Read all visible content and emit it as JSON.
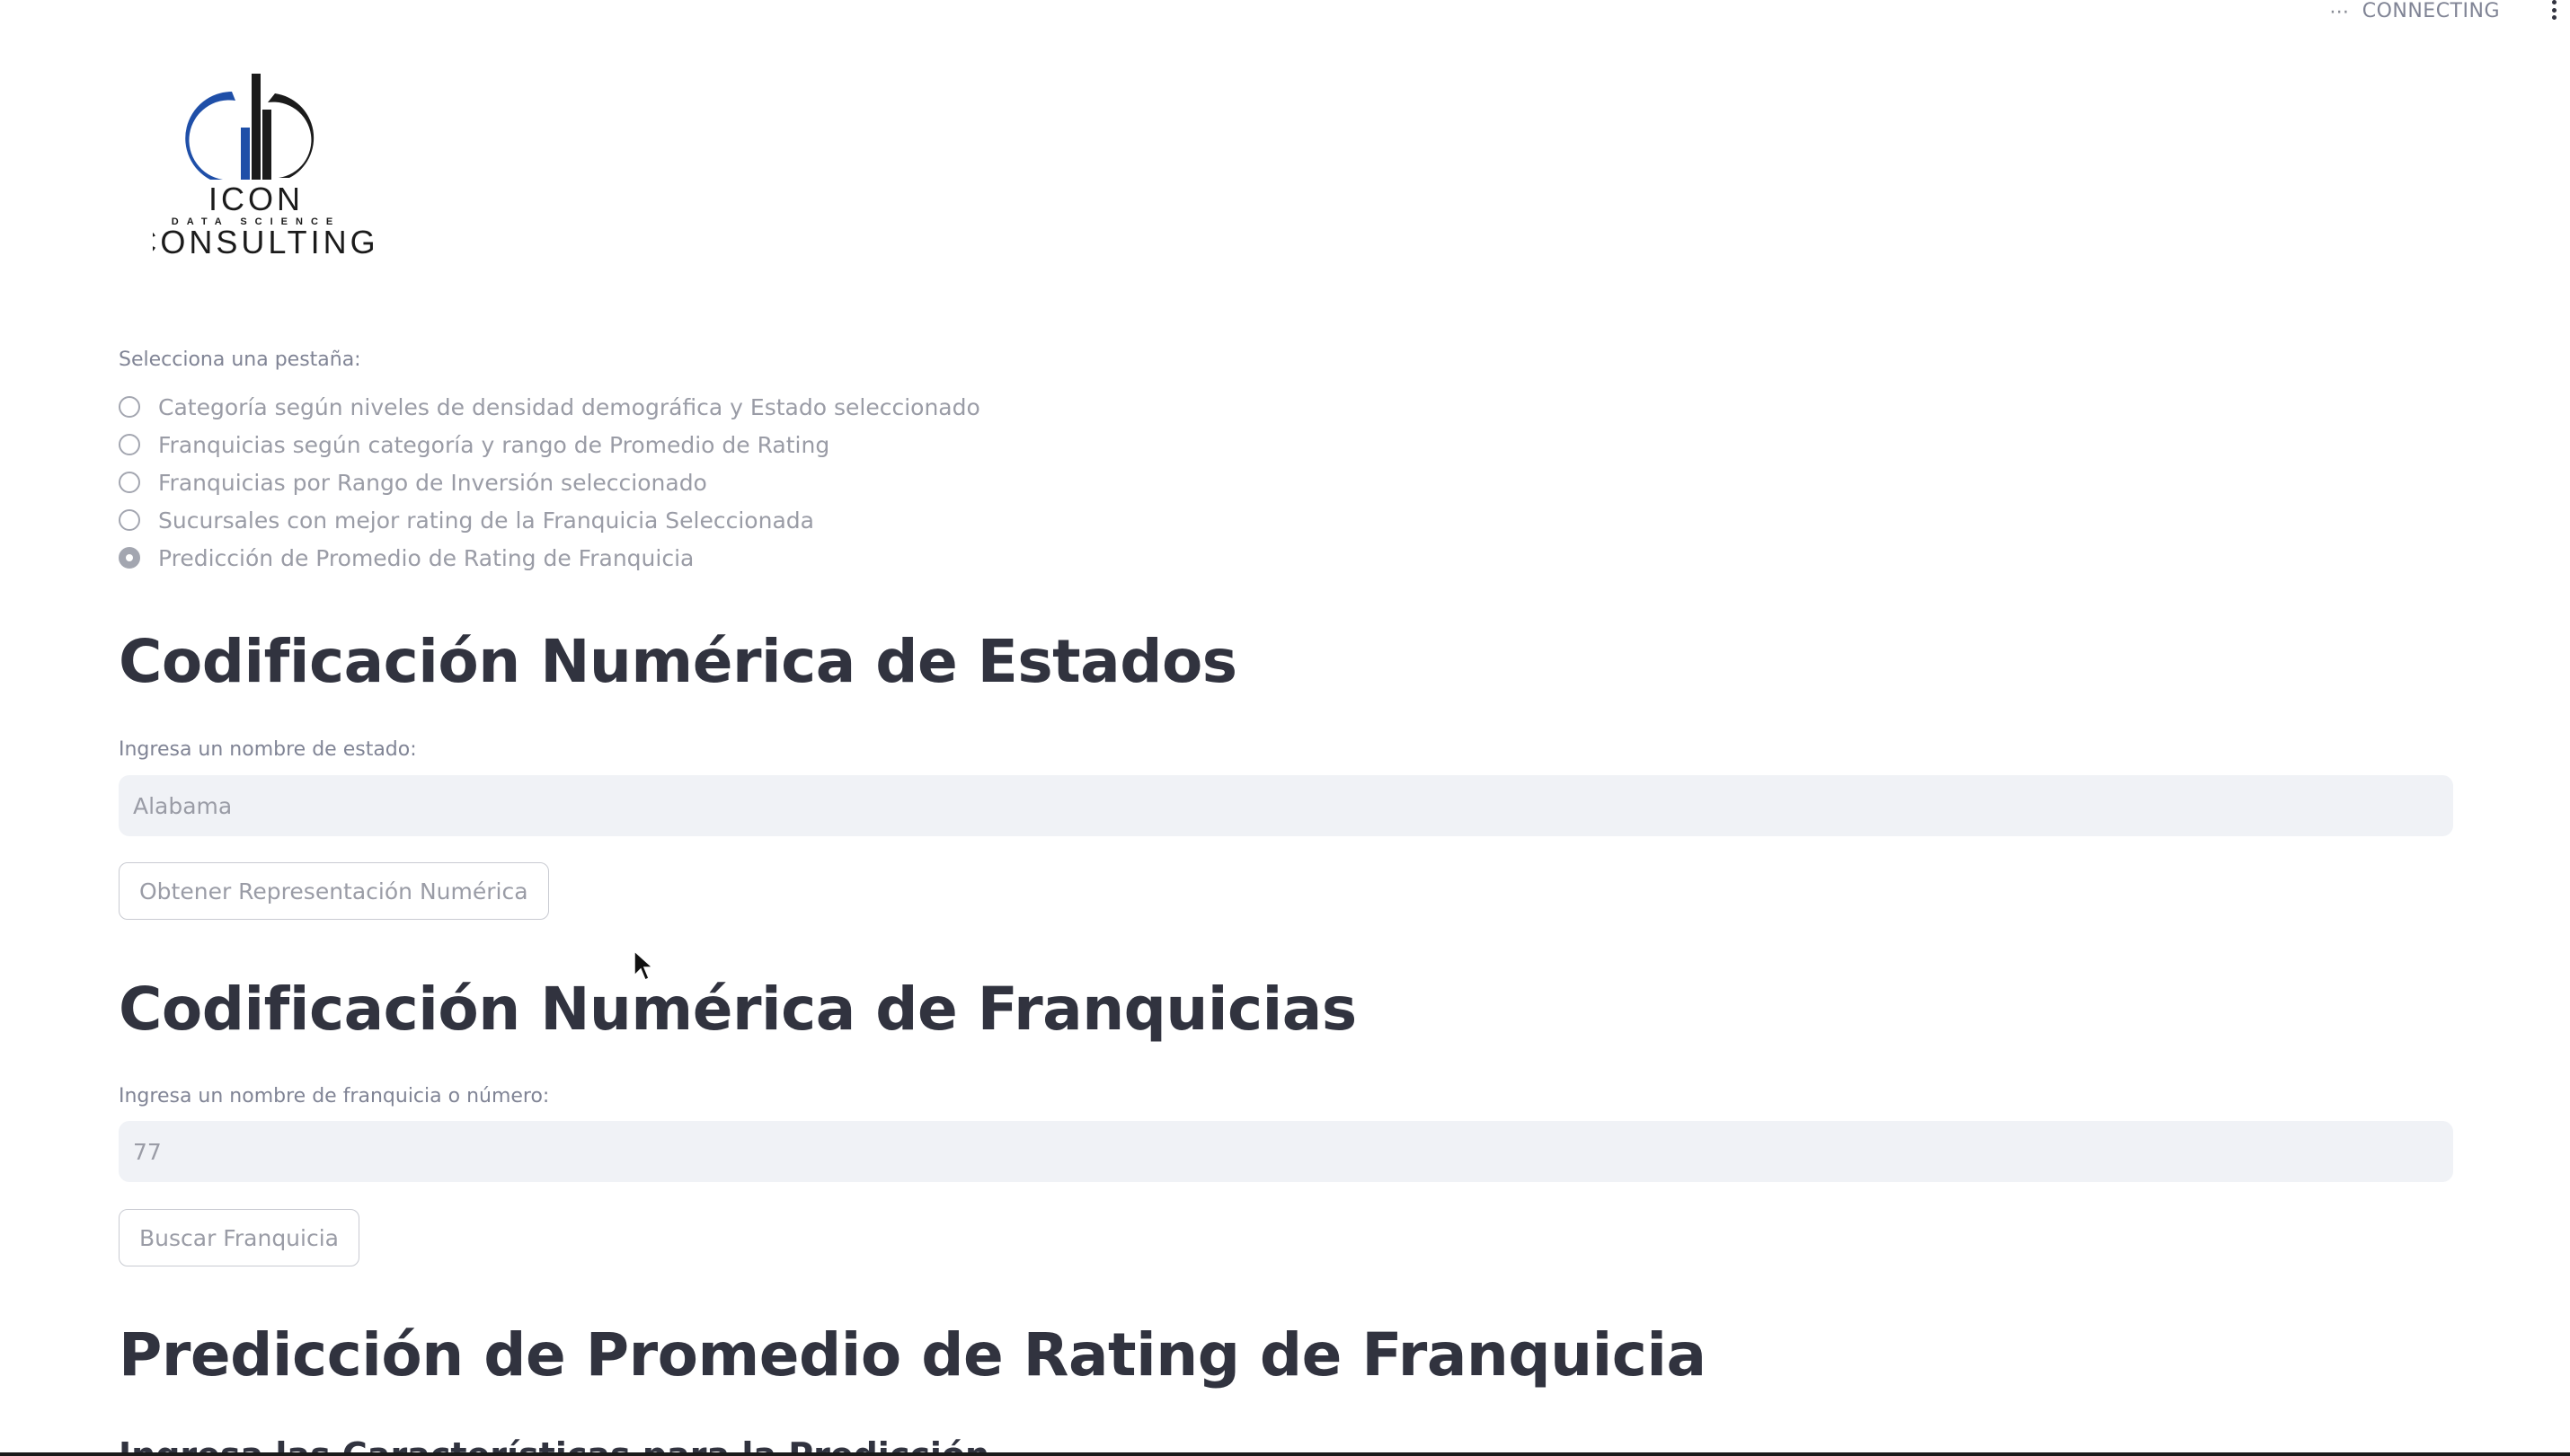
{
  "status": {
    "text": "CONNECTING"
  },
  "logo": {
    "line1": "ICON",
    "line2": "DATA SCIENCE",
    "line3": "CONSULTING"
  },
  "tab_selector": {
    "label": "Selecciona una pestaña:",
    "options": [
      {
        "label": "Categoría según niveles de densidad demográfica y Estado seleccionado",
        "selected": false
      },
      {
        "label": "Franquicias según categoría y rango de Promedio de Rating",
        "selected": false
      },
      {
        "label": "Franquicias por Rango de Inversión seleccionado",
        "selected": false
      },
      {
        "label": "Sucursales con mejor rating de la Franquicia Seleccionada",
        "selected": false
      },
      {
        "label": "Predicción de Promedio de Rating de Franquicia",
        "selected": true
      }
    ]
  },
  "states_section": {
    "title": "Codificación Numérica de Estados",
    "input_label": "Ingresa un nombre de estado:",
    "input_value": "Alabama",
    "button_label": "Obtener Representación Numérica"
  },
  "franchise_section": {
    "title": "Codificación Numérica de Franquicias",
    "input_label": "Ingresa un nombre de franquicia o número:",
    "input_value": "77",
    "button_label": "Buscar Franquicia"
  },
  "prediction_section": {
    "title": "Predicción de Promedio de Rating de Franquicia",
    "subtitle": "Ingresa las Características para la Predicción"
  },
  "colors": {
    "heading": "#31333f",
    "muted_text": "#9a9ca6",
    "input_bg": "#f0f2f6",
    "logo_blue": "#1f4fa8",
    "logo_dark": "#1b1b1b"
  }
}
